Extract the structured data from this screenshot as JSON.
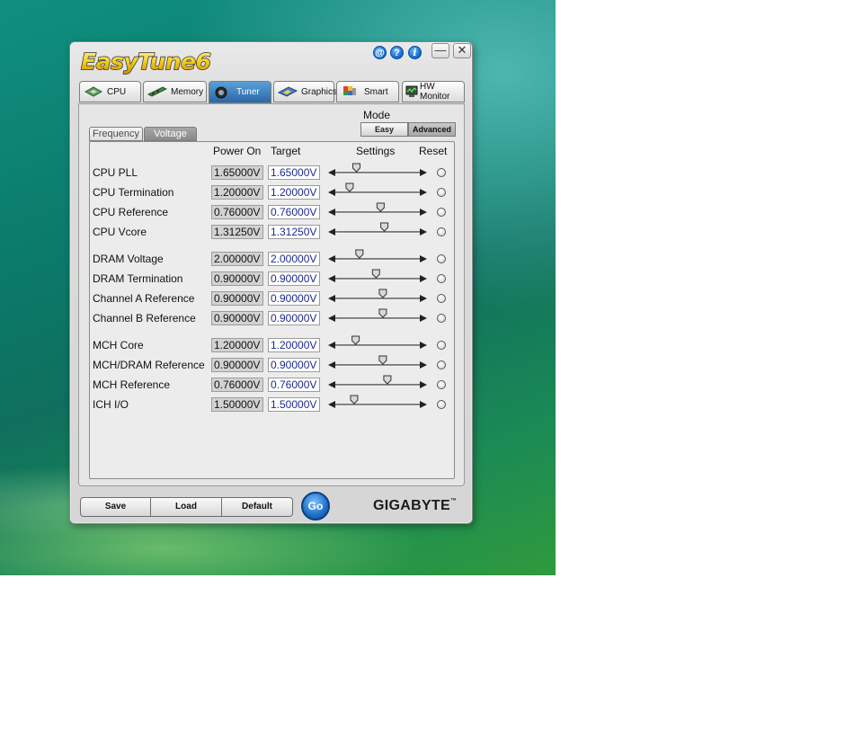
{
  "app": {
    "title": "EasyTune6",
    "title_buttons": [
      {
        "name": "web-icon",
        "glyph": "@"
      },
      {
        "name": "help-icon",
        "glyph": "?"
      },
      {
        "name": "info-icon",
        "glyph": "i"
      }
    ],
    "window_controls": {
      "minimize": "—",
      "close": "✕"
    }
  },
  "tabs": [
    {
      "label": "CPU",
      "icon": "cpu-icon",
      "active": false
    },
    {
      "label": "Memory",
      "icon": "memory-icon",
      "active": false
    },
    {
      "label": "Tuner",
      "icon": "tuner-icon",
      "active": true
    },
    {
      "label": "Graphics",
      "icon": "graphics-icon",
      "active": false
    },
    {
      "label": "Smart",
      "icon": "smart-icon",
      "active": false
    },
    {
      "label": "HW Monitor",
      "icon": "hw-monitor-icon",
      "active": false
    }
  ],
  "mode": {
    "label": "Mode",
    "options": [
      "Easy",
      "Advanced"
    ],
    "selected": "Advanced"
  },
  "subtabs": [
    {
      "label": "Frequency",
      "active": false
    },
    {
      "label": "Voltage",
      "active": true
    }
  ],
  "columns": {
    "power_on": "Power On",
    "target": "Target",
    "settings": "Settings",
    "reset": "Reset"
  },
  "voltage_rows": [
    {
      "label": "CPU PLL",
      "power_on": "1.65000V",
      "target": "1.65000V",
      "slider_level": 0.22
    },
    {
      "label": "CPU Termination",
      "power_on": "1.20000V",
      "target": "1.20000V",
      "slider_level": 0.13
    },
    {
      "label": "CPU Reference",
      "power_on": "0.76000V",
      "target": "0.76000V",
      "slider_level": 0.54
    },
    {
      "label": "CPU Vcore",
      "power_on": "1.31250V",
      "target": "1.31250V",
      "slider_level": 0.59
    },
    {
      "label": "DRAM Voltage",
      "power_on": "2.00000V",
      "target": "2.00000V",
      "slider_level": 0.26
    },
    {
      "label": "DRAM Termination",
      "power_on": "0.90000V",
      "target": "0.90000V",
      "slider_level": 0.48
    },
    {
      "label": "Channel A Reference",
      "power_on": "0.90000V",
      "target": "0.90000V",
      "slider_level": 0.57
    },
    {
      "label": "Channel B Reference",
      "power_on": "0.90000V",
      "target": "0.90000V",
      "slider_level": 0.57
    },
    {
      "label": "MCH Core",
      "power_on": "1.20000V",
      "target": "1.20000V",
      "slider_level": 0.21
    },
    {
      "label": "MCH/DRAM Reference",
      "power_on": "0.90000V",
      "target": "0.90000V",
      "slider_level": 0.57
    },
    {
      "label": "MCH Reference",
      "power_on": "0.76000V",
      "target": "0.76000V",
      "slider_level": 0.63
    },
    {
      "label": "ICH I/O",
      "power_on": "1.50000V",
      "target": "1.50000V",
      "slider_level": 0.19
    }
  ],
  "bottom": {
    "save": "Save",
    "load": "Load",
    "default": "Default",
    "go": "Go",
    "brand": "GIGABYTE",
    "brand_tm": "™"
  },
  "colors": {
    "active_tab": "#2a67a6",
    "target_text": "#1d2a8c",
    "go_button": "#1c6ec9"
  }
}
